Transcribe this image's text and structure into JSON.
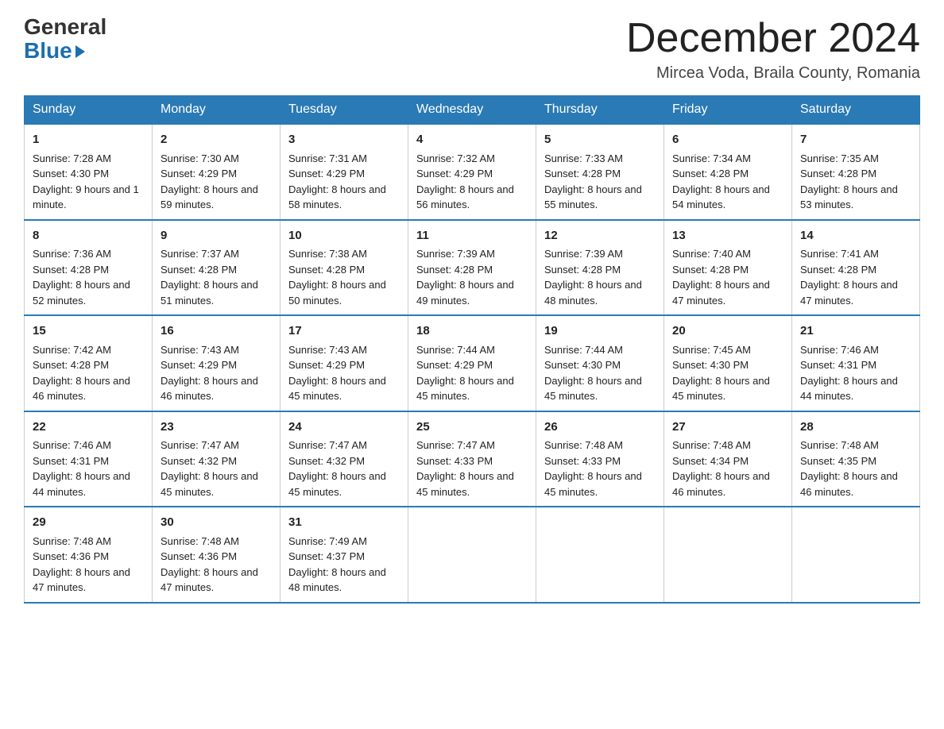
{
  "logo": {
    "general": "General",
    "blue": "Blue"
  },
  "header": {
    "month": "December 2024",
    "location": "Mircea Voda, Braila County, Romania"
  },
  "days_of_week": [
    "Sunday",
    "Monday",
    "Tuesday",
    "Wednesday",
    "Thursday",
    "Friday",
    "Saturday"
  ],
  "weeks": [
    [
      {
        "day": 1,
        "sunrise": "7:28 AM",
        "sunset": "4:30 PM",
        "daylight": "9 hours and 1 minute."
      },
      {
        "day": 2,
        "sunrise": "7:30 AM",
        "sunset": "4:29 PM",
        "daylight": "8 hours and 59 minutes."
      },
      {
        "day": 3,
        "sunrise": "7:31 AM",
        "sunset": "4:29 PM",
        "daylight": "8 hours and 58 minutes."
      },
      {
        "day": 4,
        "sunrise": "7:32 AM",
        "sunset": "4:29 PM",
        "daylight": "8 hours and 56 minutes."
      },
      {
        "day": 5,
        "sunrise": "7:33 AM",
        "sunset": "4:28 PM",
        "daylight": "8 hours and 55 minutes."
      },
      {
        "day": 6,
        "sunrise": "7:34 AM",
        "sunset": "4:28 PM",
        "daylight": "8 hours and 54 minutes."
      },
      {
        "day": 7,
        "sunrise": "7:35 AM",
        "sunset": "4:28 PM",
        "daylight": "8 hours and 53 minutes."
      }
    ],
    [
      {
        "day": 8,
        "sunrise": "7:36 AM",
        "sunset": "4:28 PM",
        "daylight": "8 hours and 52 minutes."
      },
      {
        "day": 9,
        "sunrise": "7:37 AM",
        "sunset": "4:28 PM",
        "daylight": "8 hours and 51 minutes."
      },
      {
        "day": 10,
        "sunrise": "7:38 AM",
        "sunset": "4:28 PM",
        "daylight": "8 hours and 50 minutes."
      },
      {
        "day": 11,
        "sunrise": "7:39 AM",
        "sunset": "4:28 PM",
        "daylight": "8 hours and 49 minutes."
      },
      {
        "day": 12,
        "sunrise": "7:39 AM",
        "sunset": "4:28 PM",
        "daylight": "8 hours and 48 minutes."
      },
      {
        "day": 13,
        "sunrise": "7:40 AM",
        "sunset": "4:28 PM",
        "daylight": "8 hours and 47 minutes."
      },
      {
        "day": 14,
        "sunrise": "7:41 AM",
        "sunset": "4:28 PM",
        "daylight": "8 hours and 47 minutes."
      }
    ],
    [
      {
        "day": 15,
        "sunrise": "7:42 AM",
        "sunset": "4:28 PM",
        "daylight": "8 hours and 46 minutes."
      },
      {
        "day": 16,
        "sunrise": "7:43 AM",
        "sunset": "4:29 PM",
        "daylight": "8 hours and 46 minutes."
      },
      {
        "day": 17,
        "sunrise": "7:43 AM",
        "sunset": "4:29 PM",
        "daylight": "8 hours and 45 minutes."
      },
      {
        "day": 18,
        "sunrise": "7:44 AM",
        "sunset": "4:29 PM",
        "daylight": "8 hours and 45 minutes."
      },
      {
        "day": 19,
        "sunrise": "7:44 AM",
        "sunset": "4:30 PM",
        "daylight": "8 hours and 45 minutes."
      },
      {
        "day": 20,
        "sunrise": "7:45 AM",
        "sunset": "4:30 PM",
        "daylight": "8 hours and 45 minutes."
      },
      {
        "day": 21,
        "sunrise": "7:46 AM",
        "sunset": "4:31 PM",
        "daylight": "8 hours and 44 minutes."
      }
    ],
    [
      {
        "day": 22,
        "sunrise": "7:46 AM",
        "sunset": "4:31 PM",
        "daylight": "8 hours and 44 minutes."
      },
      {
        "day": 23,
        "sunrise": "7:47 AM",
        "sunset": "4:32 PM",
        "daylight": "8 hours and 45 minutes."
      },
      {
        "day": 24,
        "sunrise": "7:47 AM",
        "sunset": "4:32 PM",
        "daylight": "8 hours and 45 minutes."
      },
      {
        "day": 25,
        "sunrise": "7:47 AM",
        "sunset": "4:33 PM",
        "daylight": "8 hours and 45 minutes."
      },
      {
        "day": 26,
        "sunrise": "7:48 AM",
        "sunset": "4:33 PM",
        "daylight": "8 hours and 45 minutes."
      },
      {
        "day": 27,
        "sunrise": "7:48 AM",
        "sunset": "4:34 PM",
        "daylight": "8 hours and 46 minutes."
      },
      {
        "day": 28,
        "sunrise": "7:48 AM",
        "sunset": "4:35 PM",
        "daylight": "8 hours and 46 minutes."
      }
    ],
    [
      {
        "day": 29,
        "sunrise": "7:48 AM",
        "sunset": "4:36 PM",
        "daylight": "8 hours and 47 minutes."
      },
      {
        "day": 30,
        "sunrise": "7:48 AM",
        "sunset": "4:36 PM",
        "daylight": "8 hours and 47 minutes."
      },
      {
        "day": 31,
        "sunrise": "7:49 AM",
        "sunset": "4:37 PM",
        "daylight": "8 hours and 48 minutes."
      },
      null,
      null,
      null,
      null
    ]
  ]
}
